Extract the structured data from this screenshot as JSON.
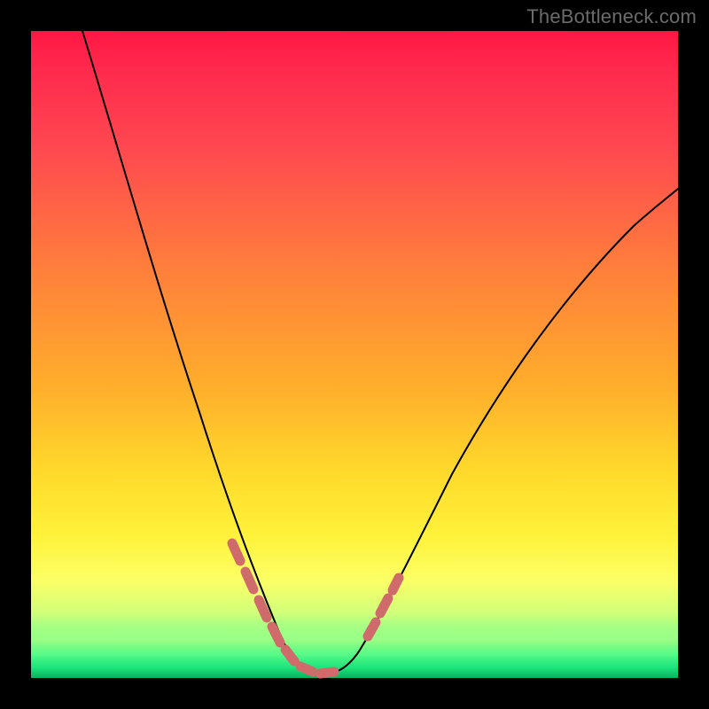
{
  "watermark": "TheBottleneck.com",
  "chart_data": {
    "type": "line",
    "title": "",
    "xlabel": "",
    "ylabel": "",
    "xlim": [
      0,
      100
    ],
    "ylim": [
      0,
      100
    ],
    "grid": false,
    "legend": false,
    "series": [
      {
        "name": "bottleneck-curve",
        "color": "#000000",
        "x": [
          8,
          12,
          16,
          20,
          24,
          28,
          31,
          33,
          35,
          37,
          39,
          41,
          43,
          45,
          48,
          52,
          56,
          60,
          66,
          74,
          82,
          90,
          98,
          100
        ],
        "y": [
          100,
          88,
          76,
          64,
          52,
          40,
          30,
          22,
          15,
          9,
          5,
          2,
          1,
          1,
          3,
          7,
          13,
          20,
          30,
          42,
          53,
          62,
          69,
          71
        ]
      },
      {
        "name": "marker-segment-left",
        "color": "#d46a6a",
        "style": "thick-dash",
        "x": [
          31,
          33,
          35,
          37,
          39,
          41,
          43,
          45
        ],
        "y": [
          21,
          14,
          8,
          5,
          2,
          1,
          1,
          2
        ]
      },
      {
        "name": "marker-segment-right",
        "color": "#d46a6a",
        "style": "thick-dash",
        "x": [
          50,
          52,
          54
        ],
        "y": [
          8,
          11,
          14
        ]
      }
    ],
    "background_gradient": {
      "top": "#ff1744",
      "upper_mid": "#ff7a3d",
      "mid": "#ffd92b",
      "lower_mid": "#fbff66",
      "bottom": "#04b85e"
    }
  }
}
